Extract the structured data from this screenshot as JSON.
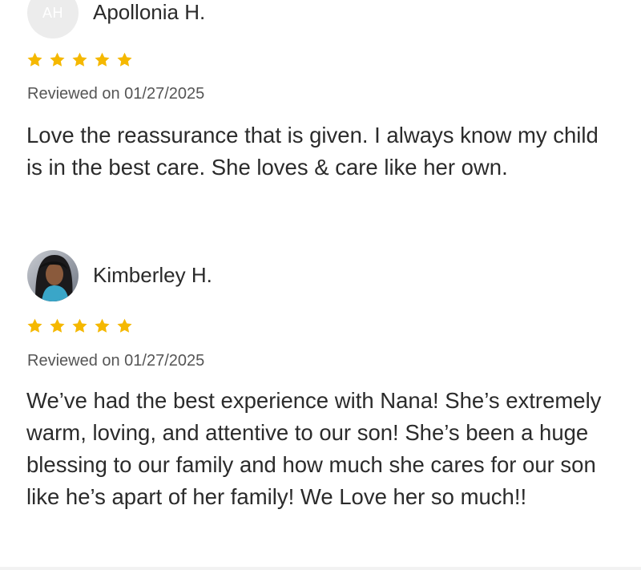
{
  "reviews": [
    {
      "avatar_initials": "AH",
      "name": "Apollonia H.",
      "rating": 5,
      "date": "Reviewed on 01/27/2025",
      "text": "Love the reassurance that is given. I always know my child is in the best care. She loves & care like her own."
    },
    {
      "avatar_initials": "",
      "name": "Kimberley H.",
      "rating": 5,
      "date": "Reviewed on 01/27/2025",
      "text": "We’ve had the best experience with Nana! She’s extremely warm, loving, and attentive to our son! She’s been a huge blessing to our family and how much she cares for our son like he’s apart of her family! We Love her so much!!"
    }
  ],
  "colors": {
    "star": "#F5B800",
    "text": "#2b2b2b",
    "date": "#555555"
  }
}
